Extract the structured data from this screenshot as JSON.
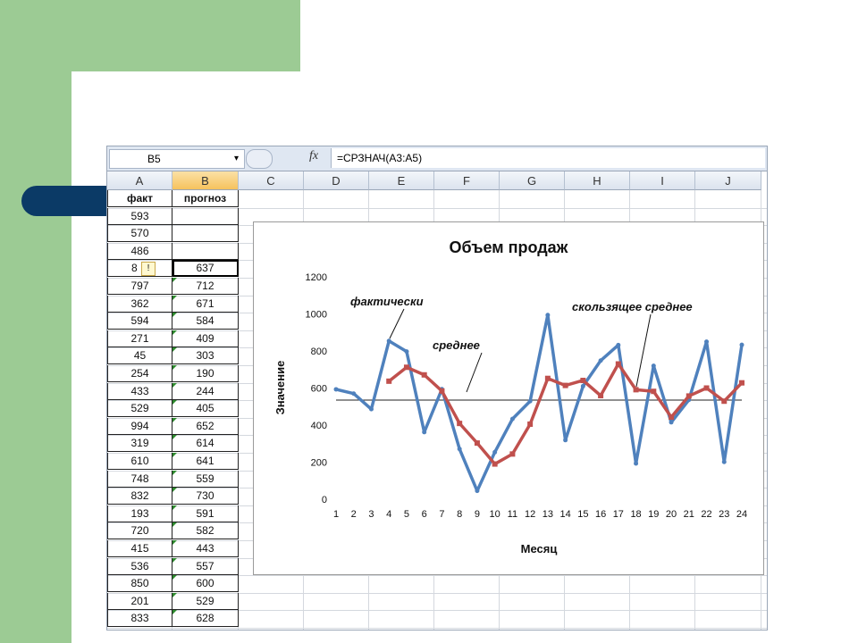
{
  "namebox": {
    "value": "B5",
    "arrow": "▾"
  },
  "formula": {
    "fx": "fx",
    "text": "=СРЗНАЧ(A3:A5)"
  },
  "columns": [
    "A",
    "B",
    "C",
    "D",
    "E",
    "F",
    "G",
    "H",
    "I",
    "J"
  ],
  "table": {
    "headers": [
      "факт",
      "прогноз"
    ],
    "rows": [
      [
        "593",
        ""
      ],
      [
        "570",
        ""
      ],
      [
        "486",
        ""
      ],
      [
        "8",
        "637"
      ],
      [
        "797",
        "712"
      ],
      [
        "362",
        "671"
      ],
      [
        "594",
        "584"
      ],
      [
        "271",
        "409"
      ],
      [
        "45",
        "303"
      ],
      [
        "254",
        "190"
      ],
      [
        "433",
        "244"
      ],
      [
        "529",
        "405"
      ],
      [
        "994",
        "652"
      ],
      [
        "319",
        "614"
      ],
      [
        "610",
        "641"
      ],
      [
        "748",
        "559"
      ],
      [
        "832",
        "730"
      ],
      [
        "193",
        "591"
      ],
      [
        "720",
        "582"
      ],
      [
        "415",
        "443"
      ],
      [
        "536",
        "557"
      ],
      [
        "850",
        "600"
      ],
      [
        "201",
        "529"
      ],
      [
        "833",
        "628"
      ]
    ]
  },
  "chart_data": {
    "type": "line",
    "title": "Объем продаж",
    "xlabel": "Месяц",
    "ylabel": "Значение",
    "x": [
      1,
      2,
      3,
      4,
      5,
      6,
      7,
      8,
      9,
      10,
      11,
      12,
      13,
      14,
      15,
      16,
      17,
      18,
      19,
      20,
      21,
      22,
      23,
      24
    ],
    "yticks": [
      "0",
      "200",
      "400",
      "600",
      "800",
      "1000",
      "1200"
    ],
    "ylim": [
      0,
      1200
    ],
    "series": [
      {
        "name": "фактически",
        "color": "#4f81bd",
        "values": [
          593,
          570,
          486,
          854,
          797,
          362,
          594,
          271,
          45,
          254,
          433,
          529,
          994,
          319,
          610,
          748,
          832,
          193,
          720,
          415,
          536,
          850,
          201,
          833
        ]
      },
      {
        "name": "скользящее среднее",
        "color": "#c0504d",
        "values": [
          null,
          null,
          null,
          637,
          712,
          671,
          584,
          409,
          303,
          190,
          244,
          405,
          652,
          614,
          641,
          559,
          730,
          591,
          582,
          443,
          557,
          600,
          529,
          628
        ]
      }
    ],
    "mean": {
      "label": "среднее",
      "value": 535
    },
    "grid": false
  }
}
